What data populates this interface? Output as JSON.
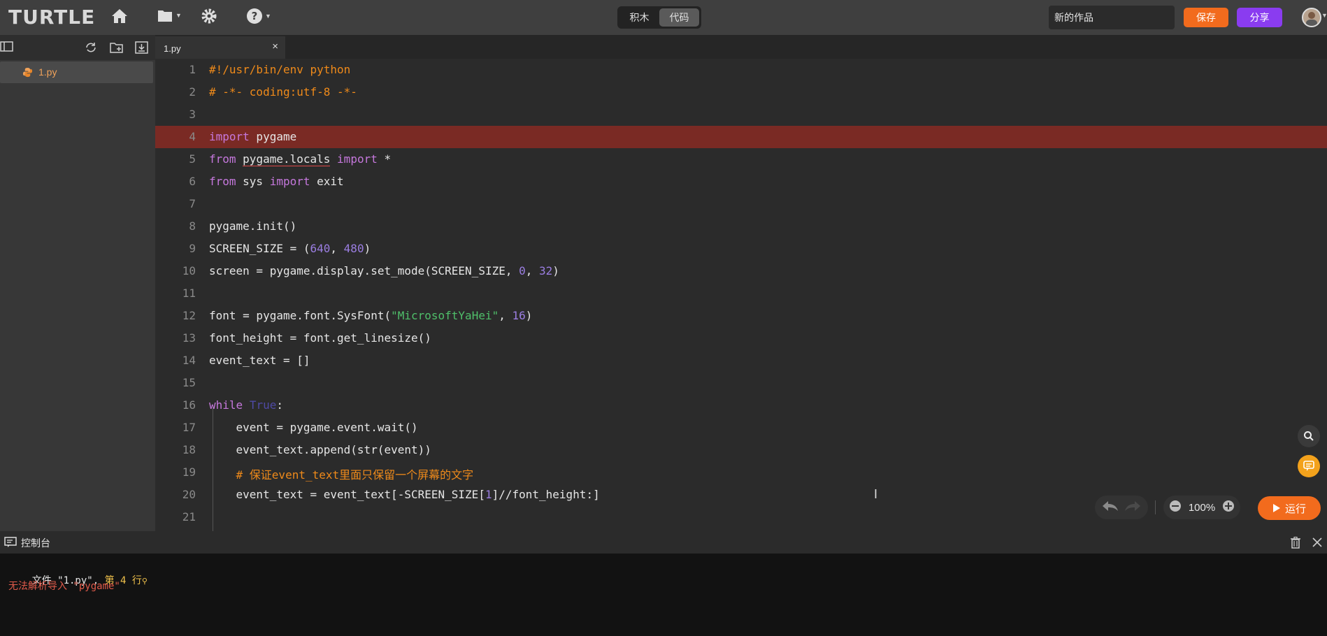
{
  "app": {
    "logo": "TURTLE"
  },
  "topbar": {
    "icons": [
      "home-icon",
      "folder-icon",
      "gear-icon",
      "help-icon"
    ],
    "mode_blocks": "积木",
    "mode_code": "代码",
    "title_value": "新的作品",
    "save_label": "保存",
    "share_label": "分享"
  },
  "sidebar": {
    "tools": [
      "sidebar-toggle-icon",
      "refresh-icon",
      "new-folder-icon",
      "download-icon"
    ],
    "files": [
      {
        "name": "1.py",
        "icon": "python-icon"
      }
    ]
  },
  "editor": {
    "tab": {
      "name": "1.py",
      "close": "×"
    },
    "lines": [
      {
        "n": "1"
      },
      {
        "n": "2"
      },
      {
        "n": "3"
      },
      {
        "n": "4"
      },
      {
        "n": "5"
      },
      {
        "n": "6"
      },
      {
        "n": "7"
      },
      {
        "n": "8"
      },
      {
        "n": "9"
      },
      {
        "n": "10"
      },
      {
        "n": "11"
      },
      {
        "n": "12"
      },
      {
        "n": "13"
      },
      {
        "n": "14"
      },
      {
        "n": "15"
      },
      {
        "n": "16"
      },
      {
        "n": "17"
      },
      {
        "n": "18"
      },
      {
        "n": "19"
      },
      {
        "n": "20"
      },
      {
        "n": "21"
      }
    ],
    "code": {
      "l1": "#!/usr/bin/env python",
      "l2": "# -*- coding:utf-8 -*-",
      "l4_kw": "import",
      "l4_rest": " pygame",
      "l5_kw1": "from",
      "l5_mod": "pygame.locals",
      "l5_kw2": "import",
      "l5_rest": " *",
      "l6_kw1": "from",
      "l6_mid": " sys ",
      "l6_kw2": "import",
      "l6_rest": " exit",
      "l8": "pygame.init()",
      "l9_a": "SCREEN_SIZE = (",
      "l9_n1": "640",
      "l9_b": ", ",
      "l9_n2": "480",
      "l9_c": ")",
      "l10_a": "screen = pygame.display.set_mode(SCREEN_SIZE, ",
      "l10_n1": "0",
      "l10_b": ", ",
      "l10_n2": "32",
      "l10_c": ")",
      "l12_a": "font = pygame.font.SysFont(",
      "l12_s": "\"MicrosoftYaHei\"",
      "l12_b": ", ",
      "l12_n": "16",
      "l12_c": ")",
      "l13": "font_height = font.get_linesize()",
      "l14": "event_text = []",
      "l16_kw": "while",
      "l16_b": "True",
      "l16_c": ":",
      "l17": "    event = pygame.event.wait()",
      "l18": "    event_text.append(str(event))",
      "l19": "    # 保证event_text里面只保留一个屏幕的文字",
      "l20_a": "    event_text = event_text[-SCREEN_SIZE[",
      "l20_n": "1",
      "l20_b": "]//font_height:]"
    }
  },
  "controls": {
    "zoom": "100%",
    "run_label": "运行",
    "float_icons": [
      "search-icon",
      "chat-icon"
    ]
  },
  "console": {
    "title": "控制台",
    "line1_a": "文件 \"1.py\", ",
    "line1_b": "第 4 行",
    "line2": "无法解析导入 \"pygame\""
  },
  "colors": {
    "accent_orange": "#f26b1d",
    "accent_purple": "#8a3cf0",
    "error_highlight": "#7a2a24",
    "error_text": "#e05a4a"
  }
}
